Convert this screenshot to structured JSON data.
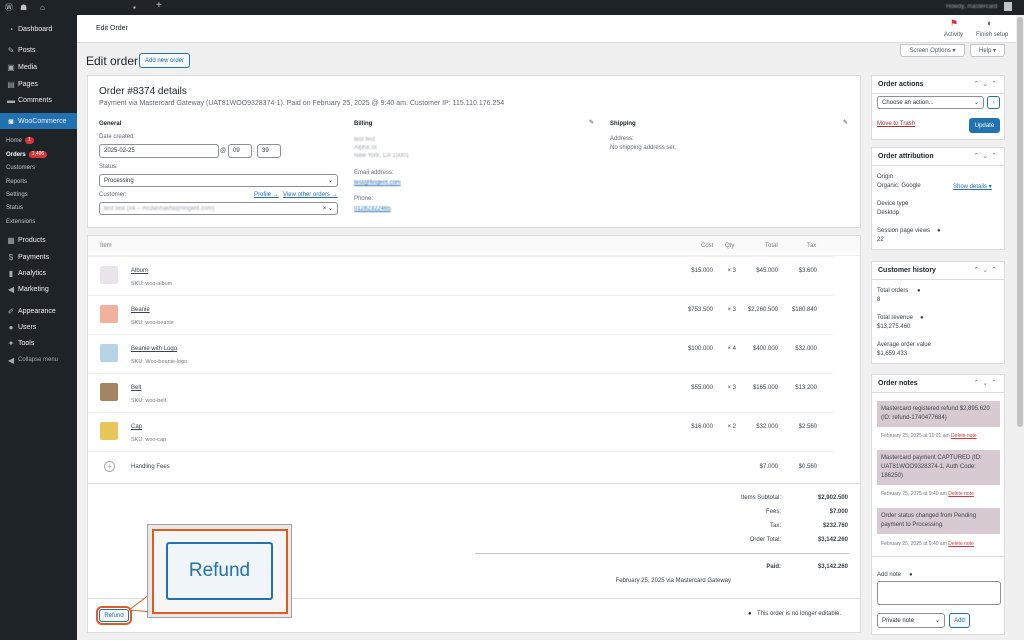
{
  "admin_bar": {
    "howdy": "Howdy, mastercard"
  },
  "sidebar": {
    "items": [
      {
        "label": "Dashboard",
        "icon": "dashboard-icon"
      },
      {
        "label": "Posts",
        "icon": "pin-icon"
      },
      {
        "label": "Media",
        "icon": "media-icon"
      },
      {
        "label": "Pages",
        "icon": "pages-icon"
      },
      {
        "label": "Comments",
        "icon": "comments-icon"
      },
      {
        "label": "WooCommerce",
        "icon": "woo-icon"
      },
      {
        "label": "Products",
        "icon": "products-icon"
      },
      {
        "label": "Payments",
        "icon": "payments-icon"
      },
      {
        "label": "Analytics",
        "icon": "analytics-icon"
      },
      {
        "label": "Marketing",
        "icon": "marketing-icon"
      },
      {
        "label": "Appearance",
        "icon": "appearance-icon"
      },
      {
        "label": "Users",
        "icon": "users-icon"
      },
      {
        "label": "Tools",
        "icon": "tools-icon"
      },
      {
        "label": "Collapse menu",
        "icon": "collapse-icon"
      }
    ],
    "woo_sub": [
      {
        "label": "Home",
        "badge": "1"
      },
      {
        "label": "Orders",
        "badge": "1,496"
      },
      {
        "label": "Customers"
      },
      {
        "label": "Reports"
      },
      {
        "label": "Settings"
      },
      {
        "label": "Status"
      },
      {
        "label": "Extensions"
      }
    ]
  },
  "topbar": {
    "title": "Edit Order",
    "activity": "Activity",
    "finish_setup": "Finish setup"
  },
  "header": {
    "page_title": "Edit order",
    "add_new": "Add new order",
    "screen_options": "Screen Options ▾",
    "help": "Help ▾"
  },
  "order": {
    "title": "Order #8374 details",
    "subtitle": "Payment via Mastercard Gateway (UAT81WOO9328374-1). Paid on February 25, 2025 @ 9:40 am. Customer IP: 115.110.176.254",
    "general": {
      "heading": "General",
      "date_label": "Date created:",
      "date": "2025-02-25",
      "at": "@",
      "hour": "09",
      "colon": ":",
      "minute": "39",
      "status_label": "Status:",
      "status": "Processing",
      "customer_label": "Customer:",
      "profile_link": "Profile →",
      "other_orders_link": "View other orders →",
      "customer": "test test (#4 – mcdashakhil@fingent.com)"
    },
    "billing": {
      "heading": "Billing",
      "address_lines": [
        "test test",
        "Alpha St",
        "New York, CA 10001"
      ],
      "email_label": "Email address:",
      "email": "test@fingent.com",
      "phone_label": "Phone:",
      "phone": "01282322465"
    },
    "shipping": {
      "heading": "Shipping",
      "address_label": "Address:",
      "address": "No shipping address set."
    }
  },
  "items_table": {
    "headers": {
      "item": "Item",
      "cost": "Cost",
      "qty": "Qty",
      "total": "Total",
      "tax": "Tax"
    },
    "rows": [
      {
        "name": "Album",
        "sku": "SKU: woo-album",
        "cost": "$15.000",
        "qty": "× 3",
        "total": "$45.000",
        "tax": "$3.600",
        "thumb_color": "#e8e4ea"
      },
      {
        "name": "Beanie",
        "sku": "SKU: woo-beanie",
        "cost": "$753.500",
        "qty": "× 3",
        "total": "$2,260.500",
        "tax": "$180.840",
        "thumb_color": "#f0b29c"
      },
      {
        "name": "Beanie with Logo",
        "sku": "SKU: Woo-beanie-logo",
        "cost": "$100.000",
        "qty": "× 4",
        "total": "$400.000",
        "tax": "$32.000",
        "thumb_color": "#b6d3e8"
      },
      {
        "name": "Belt",
        "sku": "SKU: woo-belt",
        "cost": "$55.000",
        "qty": "× 3",
        "total": "$165.000",
        "tax": "$13.200",
        "thumb_color": "#a58462"
      },
      {
        "name": "Cap",
        "sku": "SKU: woo-cap",
        "cost": "$16.000",
        "qty": "× 2",
        "total": "$32.000",
        "tax": "$2.560",
        "thumb_color": "#e9c65a"
      }
    ],
    "fee": {
      "name": "Handling Fees",
      "total": "$7.000",
      "tax": "$0.560"
    }
  },
  "totals": {
    "items_subtotal_label": "Items Subtotal:",
    "items_subtotal": "$2,902.500",
    "fees_label": "Fees:",
    "fees": "$7.000",
    "tax_label": "Tax:",
    "tax": "$232.760",
    "order_total_label": "Order Total:",
    "order_total": "$3,142.260",
    "paid_label": "Paid:",
    "paid": "$3,142.260",
    "paid_note": "February 25, 2025 via Mastercard Gateway"
  },
  "footer": {
    "refund": "Refund",
    "not_editable": "This order is no longer editable."
  },
  "callout": {
    "label": "Refund"
  },
  "order_actions": {
    "title": "Order actions",
    "choose": "Choose an action...",
    "go": "›",
    "trash": "Move to Trash",
    "update": "Update"
  },
  "attribution": {
    "title": "Order attribution",
    "origin_label": "Origin",
    "origin": "Organic: Google",
    "show_details": "Show details ▾",
    "device_label": "Device type",
    "device": "Desktop",
    "views_label": "Session page views",
    "views": "22"
  },
  "customer_history": {
    "title": "Customer history",
    "orders_label": "Total orders",
    "orders": "8",
    "revenue_label": "Total revenue",
    "revenue": "$13,275.460",
    "aov_label": "Average order value",
    "aov": "$1,659.433"
  },
  "notes": {
    "title": "Order notes",
    "items": [
      {
        "text": "Mastercard registered refund $2,895.620 (ID: refund-1740477684)",
        "meta": "February 25, 2025 at 10:01 am",
        "delete": "Delete note"
      },
      {
        "text": "Mastercard payment CAPTURED (ID: UAT81WOO9328374-1, Auth Code: 186250)",
        "meta": "February 25, 2025 at 9:40 am",
        "delete": "Delete note"
      },
      {
        "text": "Order status changed from Pending payment to Processing.",
        "meta": "February 25, 2025 at 9:40 am",
        "delete": "Delete note"
      }
    ],
    "add_label": "Add note",
    "note_type": "Private note",
    "add_btn": "Add"
  },
  "colors": {
    "wp_blue": "#2271b1",
    "sidebar_bg": "#1d2327",
    "note_bg": "#d7cad2",
    "highlight": "#e25b1f"
  }
}
